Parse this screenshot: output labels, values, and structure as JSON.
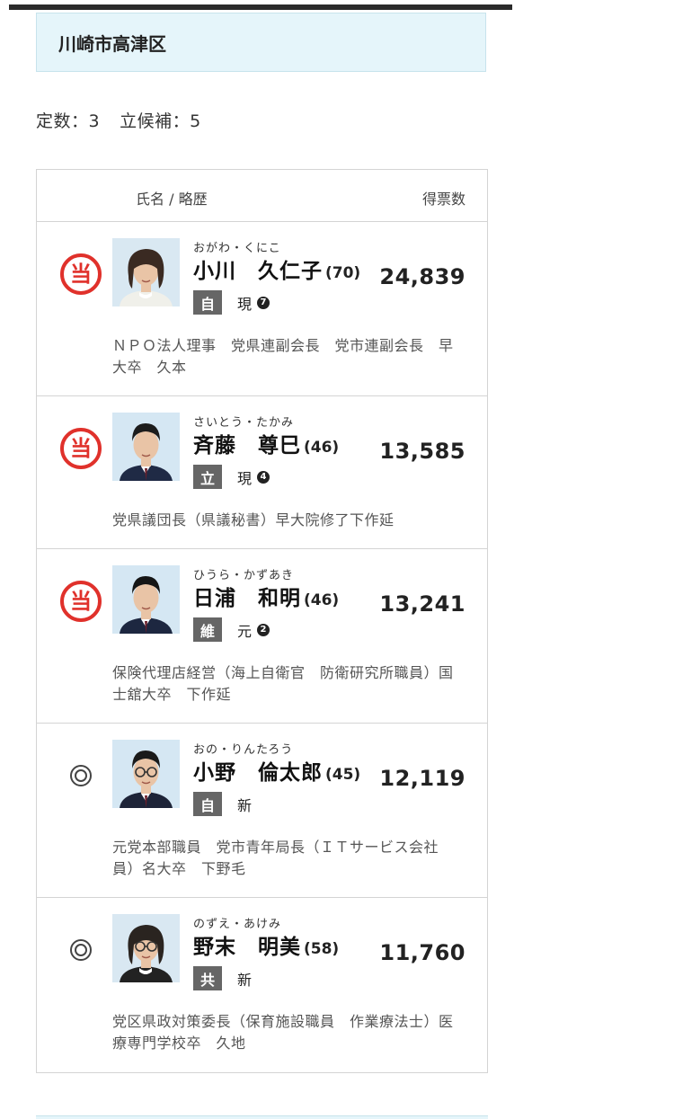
{
  "district": {
    "title": "川崎市高津区"
  },
  "seats": {
    "quota_label": "定数：3",
    "candidates_label": "立候補：5"
  },
  "table": {
    "name_header": "氏名 / 略歴",
    "votes_header": "得票数"
  },
  "candidates": [
    {
      "elected": true,
      "mark_glyph": "当",
      "kana": "おがわ・くにこ",
      "name": "小川　久仁子",
      "age": "(70)",
      "party": "自",
      "status": "現",
      "terms": "7",
      "votes": "24,839",
      "career": "ＮＰＯ法人理事　党県連副会長　党市連副会長　早大卒　久本",
      "photo": {
        "gender": "female",
        "bg": "#d9e8f2",
        "hair": "#3a2a22",
        "clothes": "#f0f0ea",
        "glasses": false
      }
    },
    {
      "elected": true,
      "mark_glyph": "当",
      "kana": "さいとう・たかみ",
      "name": "斉藤　尊巳",
      "age": "(46)",
      "party": "立",
      "status": "現",
      "terms": "4",
      "votes": "13,585",
      "career": "党県議団長（県議秘書）早大院修了下作延",
      "photo": {
        "gender": "male",
        "bg": "#d5e7f3",
        "hair": "#1c1c1c",
        "clothes": "#1f2a45",
        "glasses": false
      }
    },
    {
      "elected": true,
      "mark_glyph": "当",
      "kana": "ひうら・かずあき",
      "name": "日浦　和明",
      "age": "(46)",
      "party": "維",
      "status": "元",
      "terms": "2",
      "votes": "13,241",
      "career": "保険代理店経営（海上自衛官　防衛研究所職員）国士舘大卒　下作延",
      "photo": {
        "gender": "male",
        "bg": "#d5e7f3",
        "hair": "#151515",
        "clothes": "#1d2740",
        "glasses": false
      }
    },
    {
      "elected": false,
      "mark_glyph": "◎",
      "kana": "おの・りんたろう",
      "name": "小野　倫太郎",
      "age": "(45)",
      "party": "自",
      "status": "新",
      "terms": "",
      "votes": "12,119",
      "career": "元党本部職員　党市青年局長（ＩＴサービス会社員）名大卒　下野毛",
      "photo": {
        "gender": "male",
        "bg": "#d5e7f3",
        "hair": "#1a1a1a",
        "clothes": "#1e2438",
        "glasses": true
      }
    },
    {
      "elected": false,
      "mark_glyph": "◎",
      "kana": "のずえ・あけみ",
      "name": "野末　明美",
      "age": "(58)",
      "party": "共",
      "status": "新",
      "terms": "",
      "votes": "11,760",
      "career": "党区県政対策委長（保育施設職員　作業療法士）医療専門学校卒　久地",
      "photo": {
        "gender": "female",
        "bg": "#d9e8f2",
        "hair": "#2a2420",
        "clothes": "#222222",
        "glasses": true
      }
    }
  ],
  "colors": {
    "elected_mark": "#e0312b",
    "header_bg": "#e5f5fa",
    "party_badge": "#666666"
  }
}
